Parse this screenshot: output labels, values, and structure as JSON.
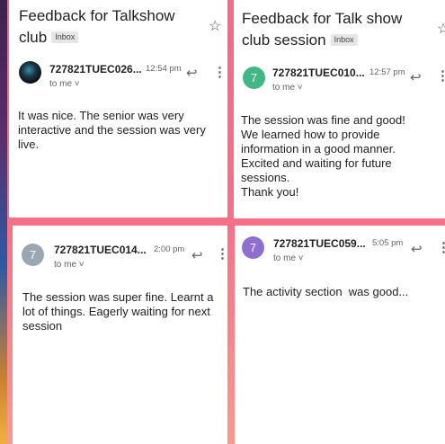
{
  "emails": [
    {
      "subject": "Feedback for Talkshow club",
      "badge": "Inbox",
      "sender": "727821TUEC026...",
      "avatar_letter": "",
      "time": "12:54 pm",
      "recipient": "to me",
      "body": "It was nice. The senior was very interactive and the session was very live."
    },
    {
      "subject": "Feedback for Talk show club session",
      "badge": "Inbox",
      "sender": "727821TUEC010...",
      "avatar_letter": "7",
      "avatar_color": "#41b883",
      "time": "12:57 pm",
      "recipient": "to me",
      "body": "The session was fine and good!\nWe learned how to provide information in a good manner.\nExcited and waiting for future sessions.\nThank you!"
    },
    {
      "sender": "727821TUEC014...",
      "avatar_letter": "7",
      "avatar_color": "#9aa7b0",
      "time": "2:00 pm",
      "recipient": "to me",
      "body": "The session was super fine. Learnt a lot of things. Eagerly waiting for next session"
    },
    {
      "sender": "727821TUEC059...",
      "avatar_letter": "7",
      "avatar_color": "#8e6ecf",
      "time": "5:05 pm",
      "recipient": "to me",
      "body": "The activity section  was good..."
    }
  ],
  "icons": {
    "star": "☆",
    "reply": "↩",
    "more": "⋮",
    "chevron": "˅"
  }
}
